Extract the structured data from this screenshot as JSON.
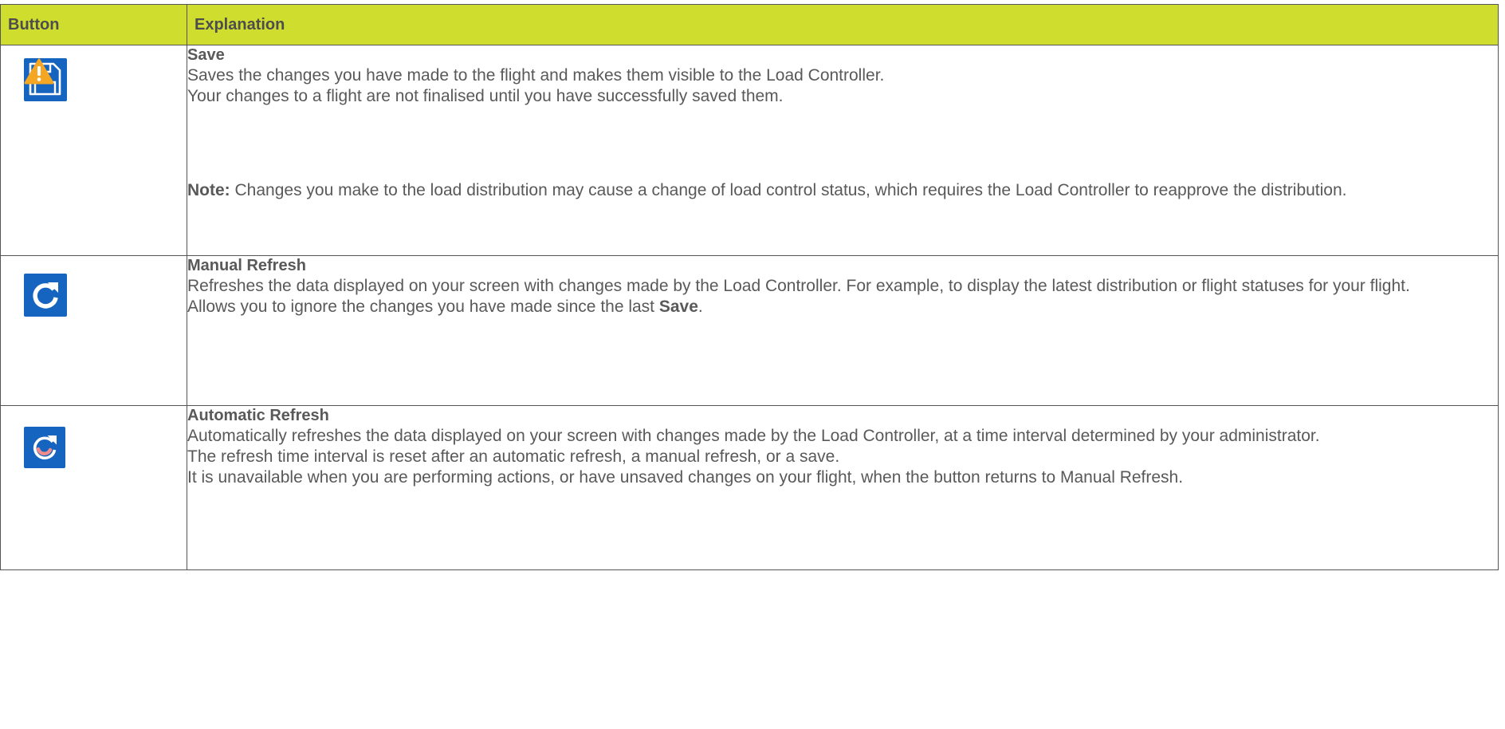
{
  "table": {
    "headers": {
      "button": "Button",
      "explanation": "Explanation"
    },
    "rows": [
      {
        "icon": "save-warning-icon",
        "title": "Save",
        "lines": [
          "Saves the changes you have made to the flight and makes them visible to the Load Controller.",
          "Your changes to a flight are not finalised until you have successfully saved them."
        ],
        "note_label": "Note:",
        "note_text": " Changes you make to the load distribution may cause a change of load control status, which requires the Load Controller to reapprove the distribution."
      },
      {
        "icon": "refresh-icon",
        "title": "Manual Refresh",
        "lines": [
          "Refreshes the data displayed on your screen with changes made by the Load Controller. For example, to display the latest distribution or flight statuses for your flight."
        ],
        "ignore_prefix": "Allows you to ignore the changes you have made since the last ",
        "ignore_bold": "Save",
        "ignore_suffix": "."
      },
      {
        "icon": "auto-refresh-icon",
        "title": "Automatic Refresh",
        "lines": [
          "Automatically refreshes the data displayed on your screen with changes made by the Load Controller, at a time interval determined by your administrator.",
          "The refresh time interval is reset after an automatic refresh, a manual refresh, or a save.",
          "It is unavailable when you are performing actions, or have unsaved changes on your flight, when the button returns to Manual Refresh."
        ]
      }
    ]
  },
  "colors": {
    "header_bg": "#cfdd2e",
    "icon_bg": "#1565c0",
    "warning": "#f5a623",
    "text": "#595959"
  }
}
